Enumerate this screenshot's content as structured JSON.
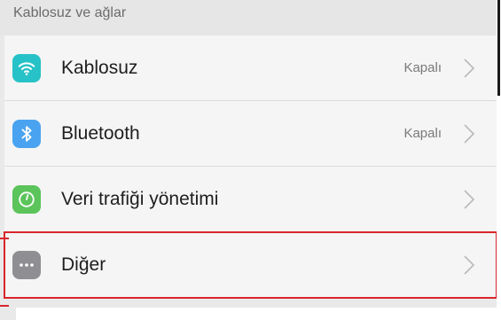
{
  "section": {
    "title": "Kablosuz ve ağlar"
  },
  "items": [
    {
      "label": "Kablosuz",
      "value": "Kapalı",
      "icon": "wifi-icon",
      "icon_color": "#27c2c7"
    },
    {
      "label": "Bluetooth",
      "value": "Kapalı",
      "icon": "bluetooth-icon",
      "icon_color": "#4aa3f0"
    },
    {
      "label": "Veri trafiği yönetimi",
      "value": "",
      "icon": "data-usage-icon",
      "icon_color": "#5bc45a"
    },
    {
      "label": "Diğer",
      "value": "",
      "icon": "more-icon",
      "icon_color": "#8e8e93"
    }
  ],
  "highlight_color": "#d8262b"
}
